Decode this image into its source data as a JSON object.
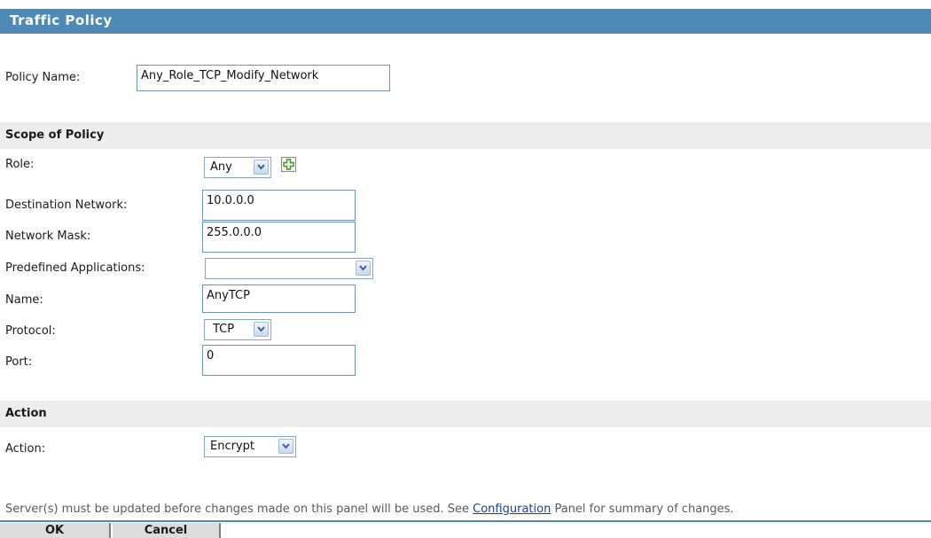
{
  "header": {
    "title": "Traffic Policy"
  },
  "policy_name": {
    "label": "Policy Name:",
    "value": "Any_Role_TCP_Modify_Network"
  },
  "scope": {
    "heading": "Scope of Policy",
    "role": {
      "label": "Role:",
      "value": "Any"
    },
    "destination_network": {
      "label": "Destination Network:",
      "value": "10.0.0.0"
    },
    "network_mask": {
      "label": "Network Mask:",
      "value": "255.0.0.0"
    },
    "predefined_applications": {
      "label": "Predefined Applications:",
      "value": ""
    },
    "name": {
      "label": "Name:",
      "value": "AnyTCP"
    },
    "protocol": {
      "label": "Protocol:",
      "value": "TCP"
    },
    "port": {
      "label": "Port:",
      "value": "0"
    }
  },
  "action_section": {
    "heading": "Action",
    "action": {
      "label": "Action:",
      "value": "Encrypt"
    }
  },
  "notice": {
    "before": "Server(s) must be updated before changes made on this panel will be used. See ",
    "link": "Configuration",
    "after": " Panel for summary of changes."
  },
  "buttons": {
    "ok": "OK",
    "cancel": "Cancel"
  },
  "colors": {
    "header_bg": "#4f89b6",
    "section_bg": "#ededed",
    "link": "#1a3e9c",
    "add_icon": "#3e9a2e"
  },
  "icons": {
    "add": "plus-icon",
    "dropdown": "chevron-down-icon"
  }
}
